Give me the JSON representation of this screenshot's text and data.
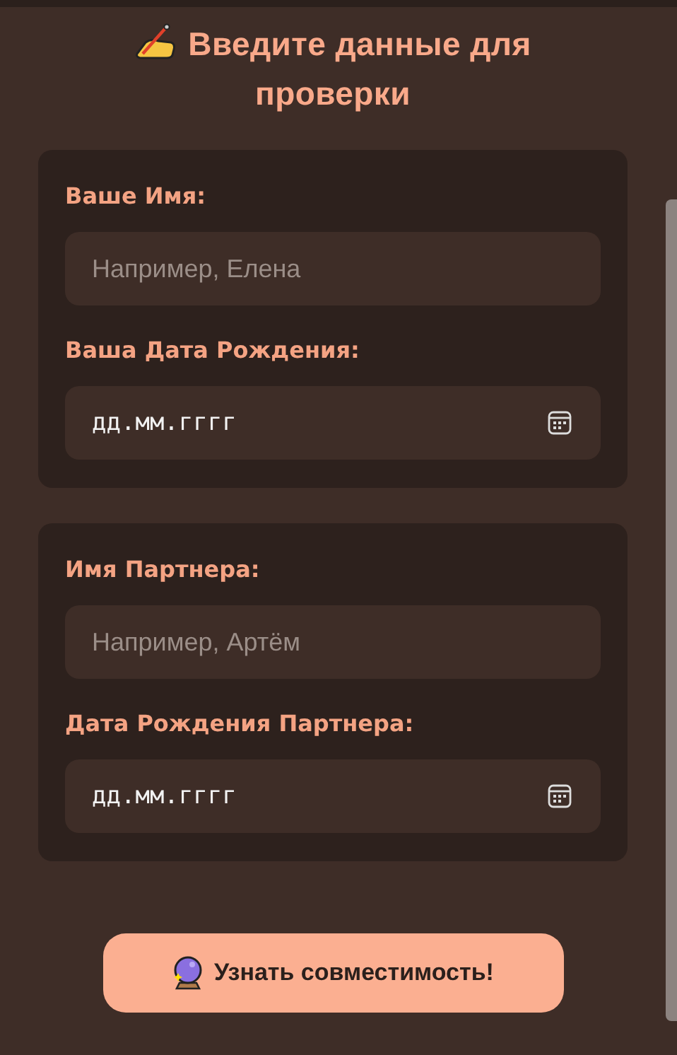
{
  "title": "Введите данные для проверки",
  "cards": [
    {
      "fields": [
        {
          "kind": "text",
          "label": "Ваше Имя:",
          "placeholder": "Например, Елена"
        },
        {
          "kind": "date",
          "label": "Ваша Дата Рождения:",
          "placeholder": "дд.мм.гггг"
        }
      ]
    },
    {
      "fields": [
        {
          "kind": "text",
          "label": "Имя Партнера:",
          "placeholder": "Например, Артём"
        },
        {
          "kind": "date",
          "label": "Дата Рождения Партнера:",
          "placeholder": "дд.мм.гггг"
        }
      ]
    }
  ],
  "submit_button": "Узнать совместимость!"
}
